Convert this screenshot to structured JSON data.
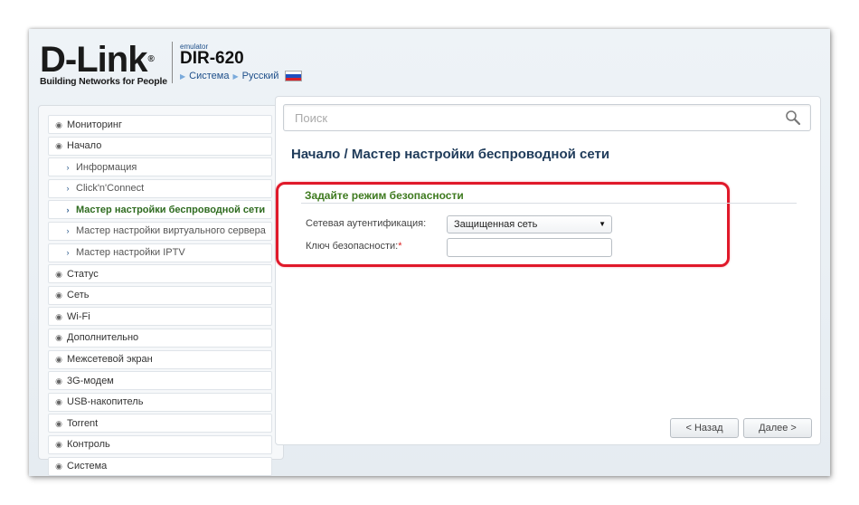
{
  "header": {
    "brand": "D-Link",
    "reg_mark": "®",
    "tagline": "Building Networks for People",
    "emulator": "emulator",
    "model": "DIR-620",
    "crumb_system": "Система",
    "crumb_language": "Русский",
    "flag_colors": [
      "#ffffff",
      "#1f4fbf",
      "#d8212a"
    ]
  },
  "sidebar": {
    "items": [
      {
        "label": "Мониторинг",
        "icon": "chevron-right-circle-icon"
      },
      {
        "label": "Начало",
        "icon": "chevron-down-circle-icon"
      },
      {
        "label": "Информация",
        "icon": "chevron-right-icon"
      },
      {
        "label": "Click'n'Connect",
        "icon": "chevron-right-icon"
      },
      {
        "label": "Мастер настройки беспроводной сети",
        "icon": "chevron-right-icon"
      },
      {
        "label": "Мастер настройки виртуального сервера",
        "icon": "chevron-right-icon"
      },
      {
        "label": "Мастер настройки IPTV",
        "icon": "chevron-right-icon"
      },
      {
        "label": "Статус",
        "icon": "chevron-right-circle-icon"
      },
      {
        "label": "Сеть",
        "icon": "chevron-right-circle-icon"
      },
      {
        "label": "Wi-Fi",
        "icon": "chevron-right-circle-icon"
      },
      {
        "label": "Дополнительно",
        "icon": "chevron-right-circle-icon"
      },
      {
        "label": "Межсетевой экран",
        "icon": "chevron-right-circle-icon"
      },
      {
        "label": "3G-модем",
        "icon": "chevron-right-circle-icon"
      },
      {
        "label": "USB-накопитель",
        "icon": "chevron-right-circle-icon"
      },
      {
        "label": "Torrent",
        "icon": "chevron-right-circle-icon"
      },
      {
        "label": "Контроль",
        "icon": "chevron-right-circle-icon"
      },
      {
        "label": "Система",
        "icon": "chevron-right-circle-icon"
      }
    ]
  },
  "main": {
    "search_placeholder": "Поиск",
    "title_section": "Начало /",
    "title_page": "Мастер настройки беспроводной сети",
    "security": {
      "heading": "Задайте режим безопасности",
      "auth_label": "Сетевая аутентификация:",
      "auth_value": "Защищенная сеть",
      "key_label": "Ключ безопасности:",
      "required_mark": "*",
      "key_value": ""
    },
    "back_button": "< Назад",
    "next_button": "Далее >"
  },
  "colors": {
    "accent_green": "#3e7a1f",
    "title_blue": "#1f3b5a",
    "highlight_red": "#e0192a"
  }
}
